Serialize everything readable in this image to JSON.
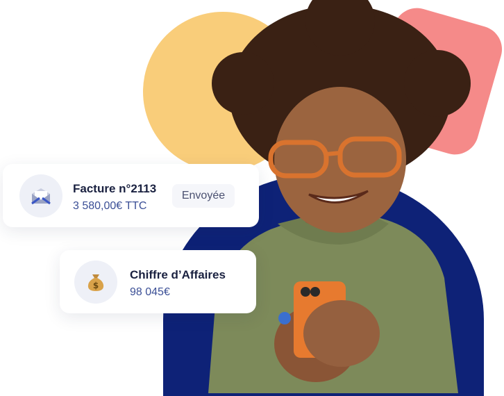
{
  "colors": {
    "yellow_circle": "#f9cd7a",
    "pink_square": "#f58a89",
    "navy_shape": "#0e2277",
    "card_title": "#1a2140",
    "card_subtitle": "#3b4f96"
  },
  "invoice_card": {
    "icon": "envelope-icon",
    "title": "Facture n°2113",
    "amount": "3 580,00€ TTC",
    "status": "Envoyée"
  },
  "revenue_card": {
    "icon": "money-bag-icon",
    "title": "Chiffre d’Affaires",
    "amount": "98 045€"
  }
}
